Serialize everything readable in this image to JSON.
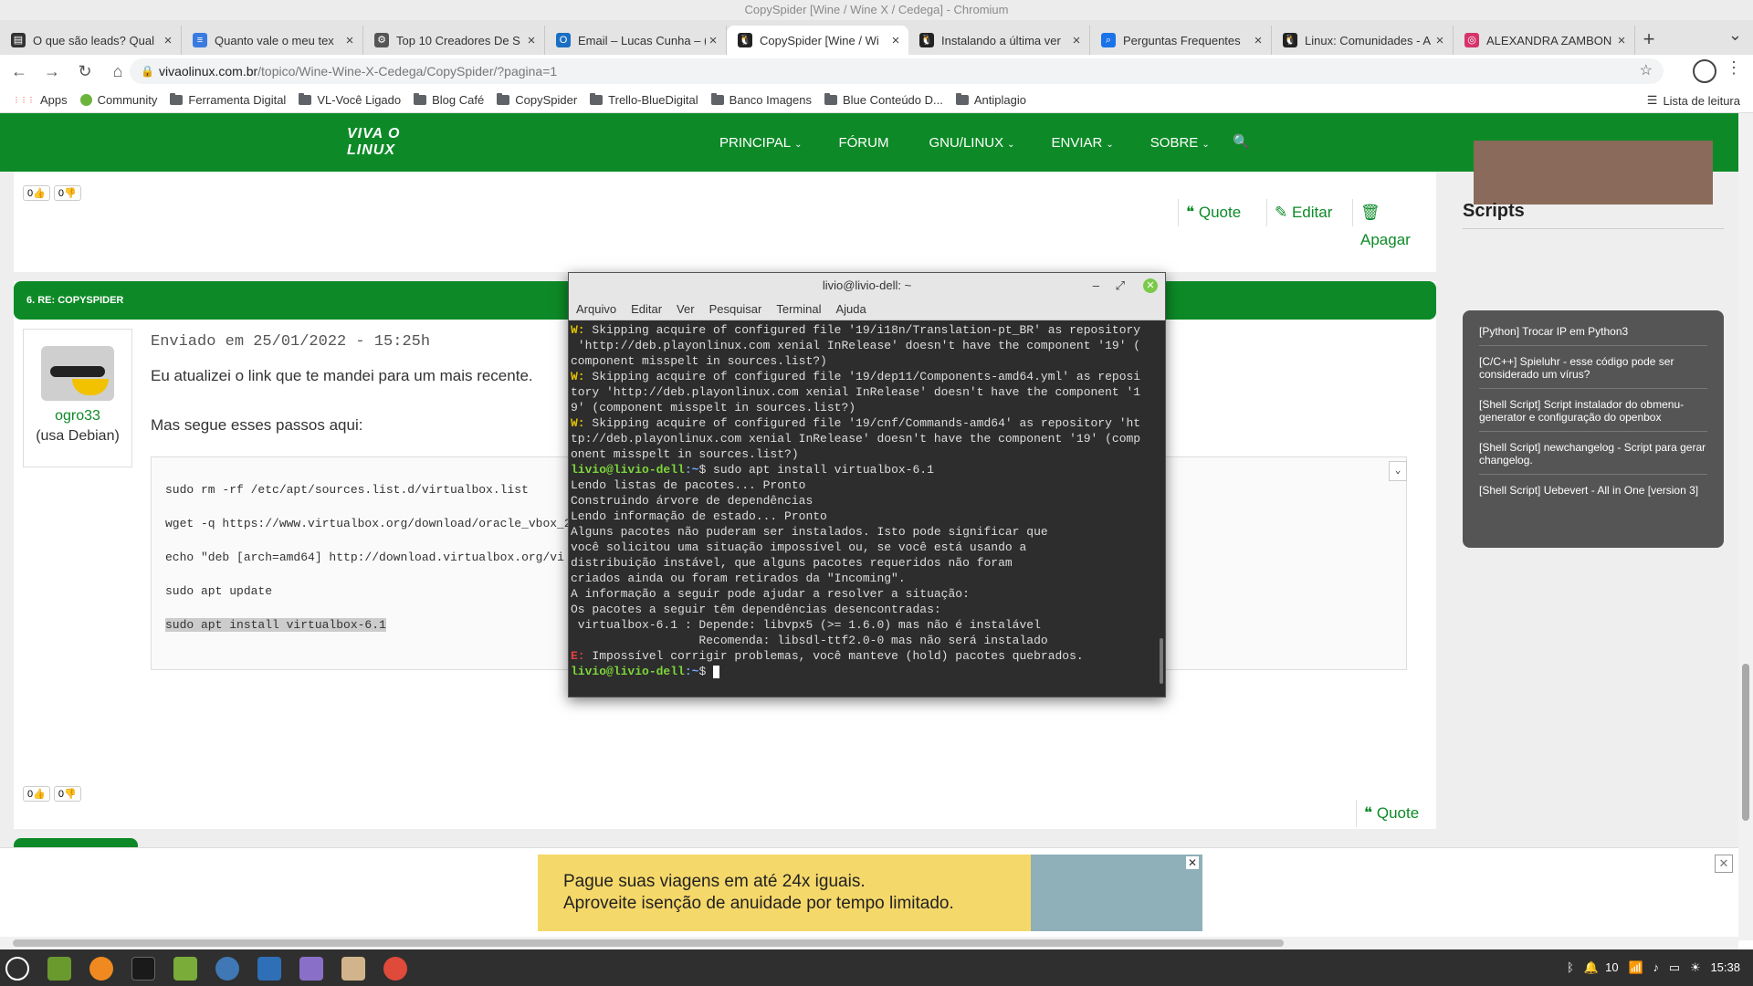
{
  "window": {
    "title": "CopySpider [Wine / Wine X / Cedega] - Chromium"
  },
  "tabs": [
    {
      "label": "O que são leads? Qual",
      "icon": "document-icon"
    },
    {
      "label": "Quanto vale o meu tex",
      "icon": "docs-icon"
    },
    {
      "label": "Top 10 Creadores De S",
      "icon": "gear-icon"
    },
    {
      "label": "Email – Lucas Cunha – (",
      "icon": "outlook-icon"
    },
    {
      "label": "CopySpider [Wine / Wi",
      "icon": "penguin-icon",
      "active": true
    },
    {
      "label": "Instalando a última ver",
      "icon": "penguin-icon"
    },
    {
      "label": "Perguntas Frequentes",
      "icon": "search-icon"
    },
    {
      "label": "Linux: Comunidades - A",
      "icon": "penguin-icon"
    },
    {
      "label": "ALEXANDRA ZAMBON",
      "icon": "instagram-icon"
    }
  ],
  "address": {
    "host": "vivaolinux.com.br",
    "path": "/topico/Wine-Wine-X-Cedega/CopySpider/?pagina=1"
  },
  "bookmarks": [
    "Apps",
    "Community",
    "Ferramenta Digital",
    "VL-Você Ligado",
    "Blog Café",
    "CopySpider",
    "Trello-BlueDigital",
    "Banco Imagens",
    "Blue Conteúdo D...",
    "Antiplagio"
  ],
  "reading_list": "Lista de leitura",
  "site": {
    "logo": "VIVA O LINUX",
    "menu": [
      "PRINCIPAL",
      "FÓRUM",
      "GNU/LINUX",
      "ENVIAR",
      "SOBRE"
    ]
  },
  "post_top": {
    "up": "0",
    "down": "0",
    "quote": "Quote",
    "edit": "Editar",
    "delete": "Apagar"
  },
  "post": {
    "header": "6. RE: COPYSPIDER",
    "user": "ogro33",
    "distro": "(usa Debian)",
    "meta": "Enviado em 25/01/2022 - 15:25h",
    "p1": "Eu atualizei o link que te mandei para um mais recente.",
    "p2": "Mas segue esses passos aqui:",
    "code": [
      "sudo rm -rf /etc/apt/sources.list.d/virtualbox.list",
      "wget -q https://www.virtualbox.org/download/oracle_vbox_2",
      "echo \"deb [arch=amd64] http://download.virtualbox.org/vi",
      "sudo apt update",
      "sudo apt install virtualbox-6.1"
    ],
    "up": "0",
    "down": "0",
    "quote": "Quote"
  },
  "sidebar": {
    "title": "Scripts",
    "items": [
      "[Python] Trocar IP em Python3",
      "[C/C++] Spieluhr - esse código pode ser considerado um vírus?",
      "[Shell Script] Script instalador do obmenu-generator e configuração do openbox",
      "[Shell Script] newchangelog - Script para gerar changelog.",
      "[Shell Script] Uebevert - All in One [version 3]"
    ]
  },
  "ad": {
    "line1": "Pague suas viagens em até 24x iguais.",
    "line2": "Aproveite isenção de anuidade por tempo limitado."
  },
  "terminal": {
    "title": "livio@livio-dell: ~",
    "menu": [
      "Arquivo",
      "Editar",
      "Ver",
      "Pesquisar",
      "Terminal",
      "Ajuda"
    ],
    "lines": [
      {
        "t": "w",
        "text": " Skipping acquire of configured file '19/i18n/Translation-pt_BR' as repository"
      },
      {
        "t": "n",
        "text": " 'http://deb.playonlinux.com xenial InRelease' doesn't have the component '19' ("
      },
      {
        "t": "n",
        "text": "component misspelt in sources.list?)"
      },
      {
        "t": "w",
        "text": " Skipping acquire of configured file '19/dep11/Components-amd64.yml' as reposi"
      },
      {
        "t": "n",
        "text": "tory 'http://deb.playonlinux.com xenial InRelease' doesn't have the component '1"
      },
      {
        "t": "n",
        "text": "9' (component misspelt in sources.list?)"
      },
      {
        "t": "w",
        "text": " Skipping acquire of configured file '19/cnf/Commands-amd64' as repository 'ht"
      },
      {
        "t": "n",
        "text": "tp://deb.playonlinux.com xenial InRelease' doesn't have the component '19' (comp"
      },
      {
        "t": "n",
        "text": "onent misspelt in sources.list?)"
      },
      {
        "t": "p",
        "text": "$ sudo apt install virtualbox-6.1"
      },
      {
        "t": "n",
        "text": "Lendo listas de pacotes... Pronto"
      },
      {
        "t": "n",
        "text": "Construindo árvore de dependências"
      },
      {
        "t": "n",
        "text": "Lendo informação de estado... Pronto"
      },
      {
        "t": "n",
        "text": "Alguns pacotes não puderam ser instalados. Isto pode significar que"
      },
      {
        "t": "n",
        "text": "você solicitou uma situação impossível ou, se você está usando a"
      },
      {
        "t": "n",
        "text": "distribuição instável, que alguns pacotes requeridos não foram"
      },
      {
        "t": "n",
        "text": "criados ainda ou foram retirados da \"Incoming\"."
      },
      {
        "t": "n",
        "text": "A informação a seguir pode ajudar a resolver a situação:"
      },
      {
        "t": "n",
        "text": ""
      },
      {
        "t": "n",
        "text": "Os pacotes a seguir têm dependências desencontradas:"
      },
      {
        "t": "n",
        "text": " virtualbox-6.1 : Depende: libvpx5 (>= 1.6.0) mas não é instalável"
      },
      {
        "t": "n",
        "text": "                  Recomenda: libsdl-ttf2.0-0 mas não será instalado"
      },
      {
        "t": "e",
        "text": " Impossível corrigir problemas, você manteve (hold) pacotes quebrados."
      },
      {
        "t": "p",
        "text": "$ "
      }
    ],
    "prompt_user": "livio@livio-dell",
    "prompt_path": ":~",
    "w_prefix": "W:",
    "e_prefix": "E:"
  },
  "taskbar": {
    "clock": "15:38",
    "volume": "10"
  }
}
